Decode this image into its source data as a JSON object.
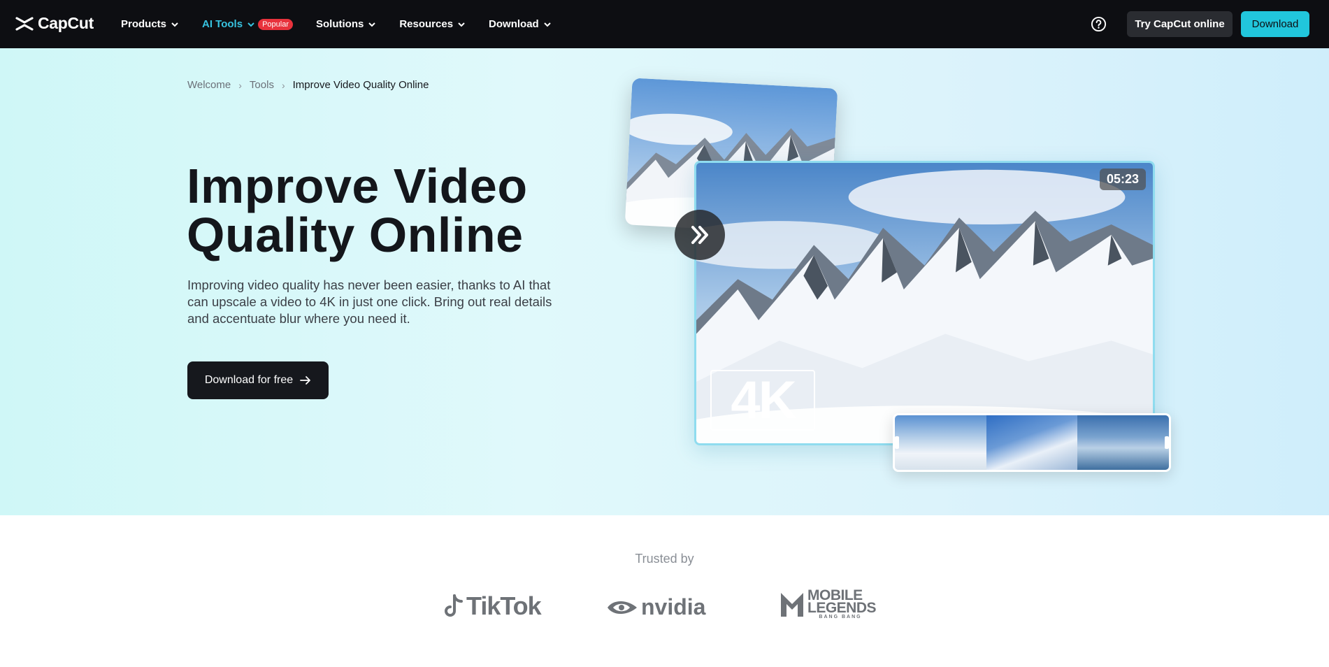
{
  "nav": {
    "logo_text": "CapCut",
    "menu": [
      {
        "label": "Products",
        "active": false
      },
      {
        "label": "AI Tools",
        "active": true,
        "badge": "Popular"
      },
      {
        "label": "Solutions",
        "active": false
      },
      {
        "label": "Resources",
        "active": false
      },
      {
        "label": "Download",
        "active": false
      }
    ],
    "help_icon": "question-circle-icon",
    "try_online_label": "Try CapCut online",
    "download_label": "Download"
  },
  "breadcrumb": [
    "Welcome",
    "Tools",
    "Improve Video Quality Online"
  ],
  "hero": {
    "title_line1": "Improve Video",
    "title_line2": "Quality Online",
    "description": "Improving video quality has never been easier, thanks to AI that can upscale a video to 4K in just one click. Bring out real details and accentuate blur where you need it.",
    "cta_label": "Download for free"
  },
  "media": {
    "timestamp": "05:23",
    "resolution_label": "4K"
  },
  "trusted": {
    "label": "Trusted by",
    "brands": [
      "TikTok",
      "NVIDIA",
      "MOBILE LEGENDS",
      "BANG BANG"
    ]
  },
  "colors": {
    "accent": "#21c6dc",
    "nav_bg": "#0d0e12",
    "badge": "#e8323c"
  }
}
